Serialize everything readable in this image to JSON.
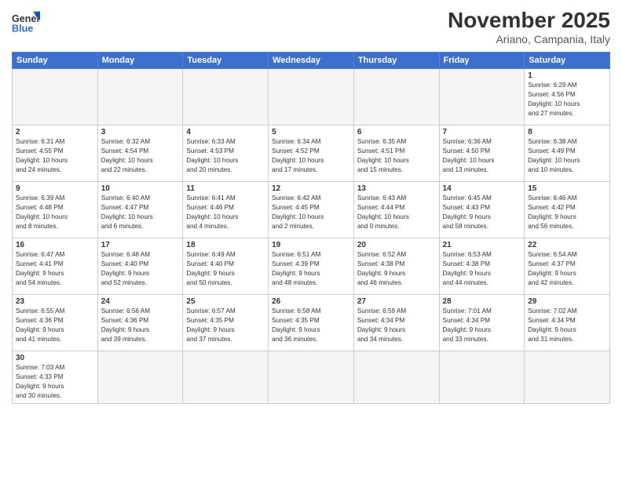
{
  "logo": {
    "text_general": "General",
    "text_blue": "Blue"
  },
  "header": {
    "month": "November 2025",
    "location": "Ariano, Campania, Italy"
  },
  "weekdays": [
    "Sunday",
    "Monday",
    "Tuesday",
    "Wednesday",
    "Thursday",
    "Friday",
    "Saturday"
  ],
  "rows": [
    [
      {
        "day": "",
        "info": ""
      },
      {
        "day": "",
        "info": ""
      },
      {
        "day": "",
        "info": ""
      },
      {
        "day": "",
        "info": ""
      },
      {
        "day": "",
        "info": ""
      },
      {
        "day": "",
        "info": ""
      },
      {
        "day": "1",
        "info": "Sunrise: 6:29 AM\nSunset: 4:56 PM\nDaylight: 10 hours\nand 27 minutes."
      }
    ],
    [
      {
        "day": "2",
        "info": "Sunrise: 6:31 AM\nSunset: 4:55 PM\nDaylight: 10 hours\nand 24 minutes."
      },
      {
        "day": "3",
        "info": "Sunrise: 6:32 AM\nSunset: 4:54 PM\nDaylight: 10 hours\nand 22 minutes."
      },
      {
        "day": "4",
        "info": "Sunrise: 6:33 AM\nSunset: 4:53 PM\nDaylight: 10 hours\nand 20 minutes."
      },
      {
        "day": "5",
        "info": "Sunrise: 6:34 AM\nSunset: 4:52 PM\nDaylight: 10 hours\nand 17 minutes."
      },
      {
        "day": "6",
        "info": "Sunrise: 6:35 AM\nSunset: 4:51 PM\nDaylight: 10 hours\nand 15 minutes."
      },
      {
        "day": "7",
        "info": "Sunrise: 6:36 AM\nSunset: 4:50 PM\nDaylight: 10 hours\nand 13 minutes."
      },
      {
        "day": "8",
        "info": "Sunrise: 6:38 AM\nSunset: 4:49 PM\nDaylight: 10 hours\nand 10 minutes."
      }
    ],
    [
      {
        "day": "9",
        "info": "Sunrise: 6:39 AM\nSunset: 4:48 PM\nDaylight: 10 hours\nand 8 minutes."
      },
      {
        "day": "10",
        "info": "Sunrise: 6:40 AM\nSunset: 4:47 PM\nDaylight: 10 hours\nand 6 minutes."
      },
      {
        "day": "11",
        "info": "Sunrise: 6:41 AM\nSunset: 4:46 PM\nDaylight: 10 hours\nand 4 minutes."
      },
      {
        "day": "12",
        "info": "Sunrise: 6:42 AM\nSunset: 4:45 PM\nDaylight: 10 hours\nand 2 minutes."
      },
      {
        "day": "13",
        "info": "Sunrise: 6:43 AM\nSunset: 4:44 PM\nDaylight: 10 hours\nand 0 minutes."
      },
      {
        "day": "14",
        "info": "Sunrise: 6:45 AM\nSunset: 4:43 PM\nDaylight: 9 hours\nand 58 minutes."
      },
      {
        "day": "15",
        "info": "Sunrise: 6:46 AM\nSunset: 4:42 PM\nDaylight: 9 hours\nand 56 minutes."
      }
    ],
    [
      {
        "day": "16",
        "info": "Sunrise: 6:47 AM\nSunset: 4:41 PM\nDaylight: 9 hours\nand 54 minutes."
      },
      {
        "day": "17",
        "info": "Sunrise: 6:48 AM\nSunset: 4:40 PM\nDaylight: 9 hours\nand 52 minutes."
      },
      {
        "day": "18",
        "info": "Sunrise: 6:49 AM\nSunset: 4:40 PM\nDaylight: 9 hours\nand 50 minutes."
      },
      {
        "day": "19",
        "info": "Sunrise: 6:51 AM\nSunset: 4:39 PM\nDaylight: 9 hours\nand 48 minutes."
      },
      {
        "day": "20",
        "info": "Sunrise: 6:52 AM\nSunset: 4:38 PM\nDaylight: 9 hours\nand 46 minutes."
      },
      {
        "day": "21",
        "info": "Sunrise: 6:53 AM\nSunset: 4:38 PM\nDaylight: 9 hours\nand 44 minutes."
      },
      {
        "day": "22",
        "info": "Sunrise: 6:54 AM\nSunset: 4:37 PM\nDaylight: 9 hours\nand 42 minutes."
      }
    ],
    [
      {
        "day": "23",
        "info": "Sunrise: 6:55 AM\nSunset: 4:36 PM\nDaylight: 9 hours\nand 41 minutes."
      },
      {
        "day": "24",
        "info": "Sunrise: 6:56 AM\nSunset: 4:36 PM\nDaylight: 9 hours\nand 39 minutes."
      },
      {
        "day": "25",
        "info": "Sunrise: 6:57 AM\nSunset: 4:35 PM\nDaylight: 9 hours\nand 37 minutes."
      },
      {
        "day": "26",
        "info": "Sunrise: 6:58 AM\nSunset: 4:35 PM\nDaylight: 9 hours\nand 36 minutes."
      },
      {
        "day": "27",
        "info": "Sunrise: 6:59 AM\nSunset: 4:34 PM\nDaylight: 9 hours\nand 34 minutes."
      },
      {
        "day": "28",
        "info": "Sunrise: 7:01 AM\nSunset: 4:34 PM\nDaylight: 9 hours\nand 33 minutes."
      },
      {
        "day": "29",
        "info": "Sunrise: 7:02 AM\nSunset: 4:34 PM\nDaylight: 9 hours\nand 31 minutes."
      }
    ],
    [
      {
        "day": "30",
        "info": "Sunrise: 7:03 AM\nSunset: 4:33 PM\nDaylight: 9 hours\nand 30 minutes."
      },
      {
        "day": "",
        "info": ""
      },
      {
        "day": "",
        "info": ""
      },
      {
        "day": "",
        "info": ""
      },
      {
        "day": "",
        "info": ""
      },
      {
        "day": "",
        "info": ""
      },
      {
        "day": "",
        "info": ""
      }
    ]
  ]
}
